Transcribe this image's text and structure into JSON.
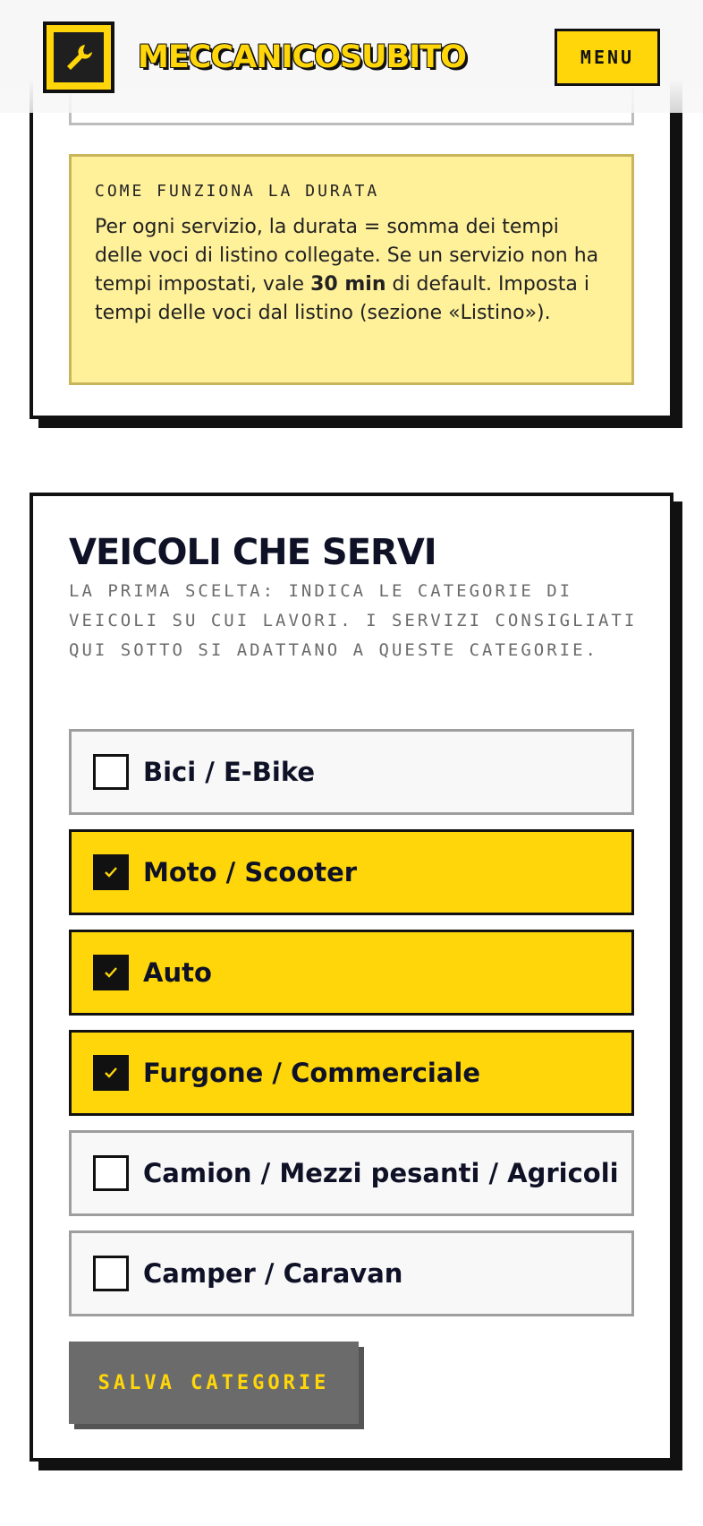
{
  "header": {
    "logo_icon": "wrench-icon",
    "brand": "MECCANICOSUBITO",
    "menu_label": "MENU"
  },
  "duration_info": {
    "title": "COME FUNZIONA LA DURATA",
    "text_before": "Per ogni servizio, la durata = somma dei tempi delle voci di listino collegate. Se un servizio non ha tempi impostati, vale ",
    "text_bold": "30 min",
    "text_after": " di default. Imposta i tempi delle voci dal listino (sezione «Listino»)."
  },
  "vehicles": {
    "title": "VEICOLI CHE SERVI",
    "subtitle": "LA PRIMA SCELTA: INDICA LE CATEGORIE DI VEICOLI SU CUI LAVORI. I SERVIZI CONSIGLIATI QUI SOTTO SI ADATTANO A QUESTE CATEGORIE.",
    "options": [
      {
        "label": "Bici / E-Bike",
        "checked": false
      },
      {
        "label": "Moto / Scooter",
        "checked": true
      },
      {
        "label": "Auto",
        "checked": true
      },
      {
        "label": "Furgone / Commerciale",
        "checked": true
      },
      {
        "label": "Camion / Mezzi pesanti / Agricoli",
        "checked": false
      },
      {
        "label": "Camper / Caravan",
        "checked": false
      }
    ],
    "save_label": "SALVA CATEGORIE"
  },
  "colors": {
    "accent": "#ffd60a",
    "ink": "#0f1226",
    "info_bg": "#fff09a",
    "disabled_button": "#6b6b6b"
  }
}
